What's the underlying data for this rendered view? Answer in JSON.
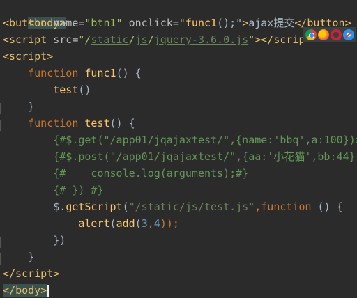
{
  "code": {
    "l1": {
      "open": "<",
      "tag": "body",
      "close": ">"
    },
    "l2": {
      "open": "<",
      "tag": "button",
      "a1": "name=",
      "v1": "\"btn1\"",
      "a2": "onclick=",
      "v2a": "\"",
      "v2fn": "func1",
      "v2b": "();\"",
      "gt": ">",
      "text": "ajax提交",
      "endOpen": "</",
      "endTag": "button",
      "endClose": ">"
    },
    "l3": {
      "open": "<",
      "tag": "script",
      "a1": "src=",
      "q1": "\"/",
      "p1": "static",
      "s1": "/",
      "p2": "js",
      "s2": "/",
      "p3": "jquery-3.6.0.js",
      "q2": "\"",
      "gt": "></",
      "endTag": "scrip"
    },
    "l4": {
      "open": "<",
      "tag": "script",
      "close": ">"
    },
    "l5": {
      "kw": "function",
      "name": "func1",
      "rest": "() {"
    },
    "l6": {
      "call": "test",
      "rest": "()"
    },
    "l7": {
      "text": "}"
    },
    "l8": {
      "kw": "function",
      "name": "test",
      "rest": "() {"
    },
    "l9": {
      "text": "{#$.get(\"/app01/jqajaxtest/\",{name:'bbq',a:100})#"
    },
    "l10": {
      "text": "{#$.post(\"/app01/jqajaxtest/\",{aa:'小花猫',bb:44},"
    },
    "l11": {
      "text": "{#    console.log(arguments);#}"
    },
    "l12": {
      "text": "{# }) #}"
    },
    "l13": {
      "obj": "$",
      "dot": ".",
      "method": "getScript",
      "paren": "(",
      "str": "\"/static/js/test.js\"",
      "comma": ",",
      "kw": "function",
      "rest": " () {"
    },
    "l14": {
      "fn": "alert",
      "p1": "(",
      "fn2": "add",
      "p2": "(",
      "n1": "3",
      "comma": ",",
      "n2": "4",
      "end": "));"
    },
    "l15": {
      "text": "})"
    },
    "l16": {
      "text": "}"
    },
    "l17": {
      "open": "<",
      "tag": "/script",
      "close": ">"
    },
    "l18": {
      "open": "</",
      "tag": "body",
      "close": ">"
    }
  },
  "browsers": [
    "chrome-icon",
    "firefox-icon",
    "opera-icon",
    "safari-icon"
  ]
}
